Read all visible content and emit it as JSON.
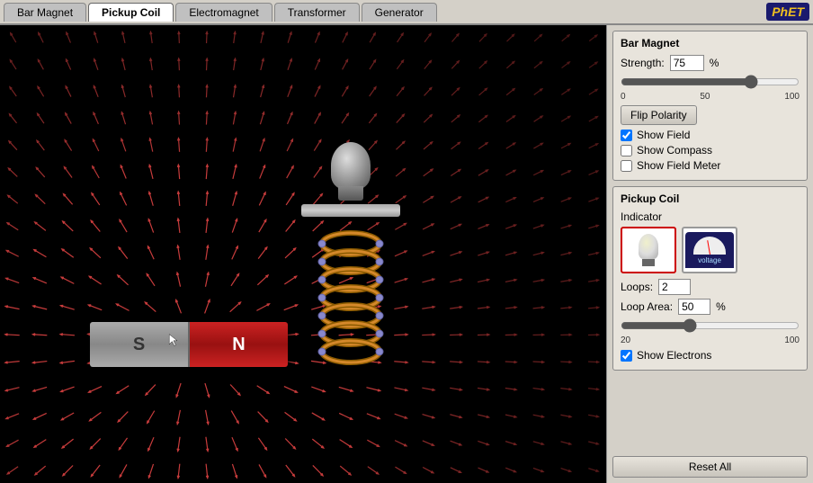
{
  "tabs": [
    {
      "id": "bar-magnet",
      "label": "Bar Magnet",
      "active": false
    },
    {
      "id": "pickup-coil",
      "label": "Pickup Coil",
      "active": true
    },
    {
      "id": "electromagnet",
      "label": "Electromagnet",
      "active": false
    },
    {
      "id": "transformer",
      "label": "Transformer",
      "active": false
    },
    {
      "id": "generator",
      "label": "Generator",
      "active": false
    }
  ],
  "logo": "PhET",
  "bar_magnet_panel": {
    "title": "Bar Magnet",
    "strength_label": "Strength:",
    "strength_value": "75",
    "strength_unit": "%",
    "slider_min": "0",
    "slider_max": "100",
    "slider_mid": "50",
    "flip_polarity_label": "Flip Polarity",
    "show_field_label": "Show Field",
    "show_field_checked": true,
    "show_compass_label": "Show Compass",
    "show_compass_checked": false,
    "show_field_meter_label": "Show Field Meter",
    "show_field_meter_checked": false
  },
  "pickup_coil_panel": {
    "title": "Pickup Coil",
    "indicator_label": "Indicator",
    "loops_label": "Loops:",
    "loops_value": "2",
    "loop_area_label": "Loop Area:",
    "loop_area_value": "50",
    "loop_area_unit": "%",
    "loop_area_min": "20",
    "loop_area_max": "100",
    "show_electrons_label": "Show Electrons",
    "show_electrons_checked": true
  },
  "magnet": {
    "s_label": "S",
    "n_label": "N"
  },
  "footer": {
    "reset_label": "Reset All"
  }
}
